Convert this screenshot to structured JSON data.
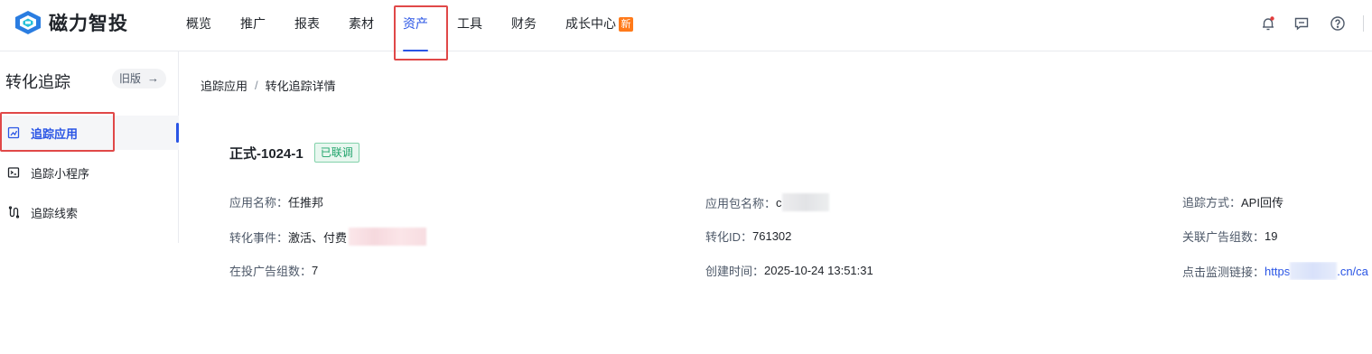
{
  "brand": {
    "name": "磁力智投",
    "accent": "#2a55e5",
    "logo_icon": "cili-logo-icon"
  },
  "nav": {
    "items": [
      {
        "label": "概览"
      },
      {
        "label": "推广"
      },
      {
        "label": "报表"
      },
      {
        "label": "素材"
      },
      {
        "label": "资产",
        "active": true
      },
      {
        "label": "工具"
      },
      {
        "label": "财务"
      },
      {
        "label": "成长中心",
        "badge": "新"
      }
    ]
  },
  "top_icons": [
    "bell-icon",
    "message-icon",
    "help-icon"
  ],
  "sidebar": {
    "title": "转化追踪",
    "old_version_label": "旧版",
    "old_version_arrow": "→",
    "items": [
      {
        "label": "追踪应用",
        "icon": "app-track-icon",
        "active": true
      },
      {
        "label": "追踪小程序",
        "icon": "miniprogram-icon"
      },
      {
        "label": "追踪线索",
        "icon": "lead-track-icon"
      }
    ]
  },
  "breadcrumb": {
    "parent": "追踪应用",
    "separator": "/",
    "current": "转化追踪详情"
  },
  "detail": {
    "name": "正式-1024-1",
    "status": "已联调",
    "fields": {
      "app_name": {
        "label": "应用名称：",
        "value": "任推邦"
      },
      "package_name": {
        "label": "应用包名称：",
        "value": "c"
      },
      "track_method": {
        "label": "追踪方式：",
        "value": "API回传"
      },
      "events": {
        "label": "转化事件：",
        "value": "激活、付费"
      },
      "conversion_id": {
        "label": "转化ID：",
        "value": "761302"
      },
      "linked_groups": {
        "label": "关联广告组数：",
        "value": "19"
      },
      "active_groups": {
        "label": "在投广告组数：",
        "value": "7"
      },
      "created_time": {
        "label": "创建时间：",
        "value": "2025-10-24 13:51:31"
      },
      "click_url": {
        "label": "点击监测链接：",
        "value_prefix": "https",
        "value_suffix": ".cn/ca"
      }
    }
  }
}
